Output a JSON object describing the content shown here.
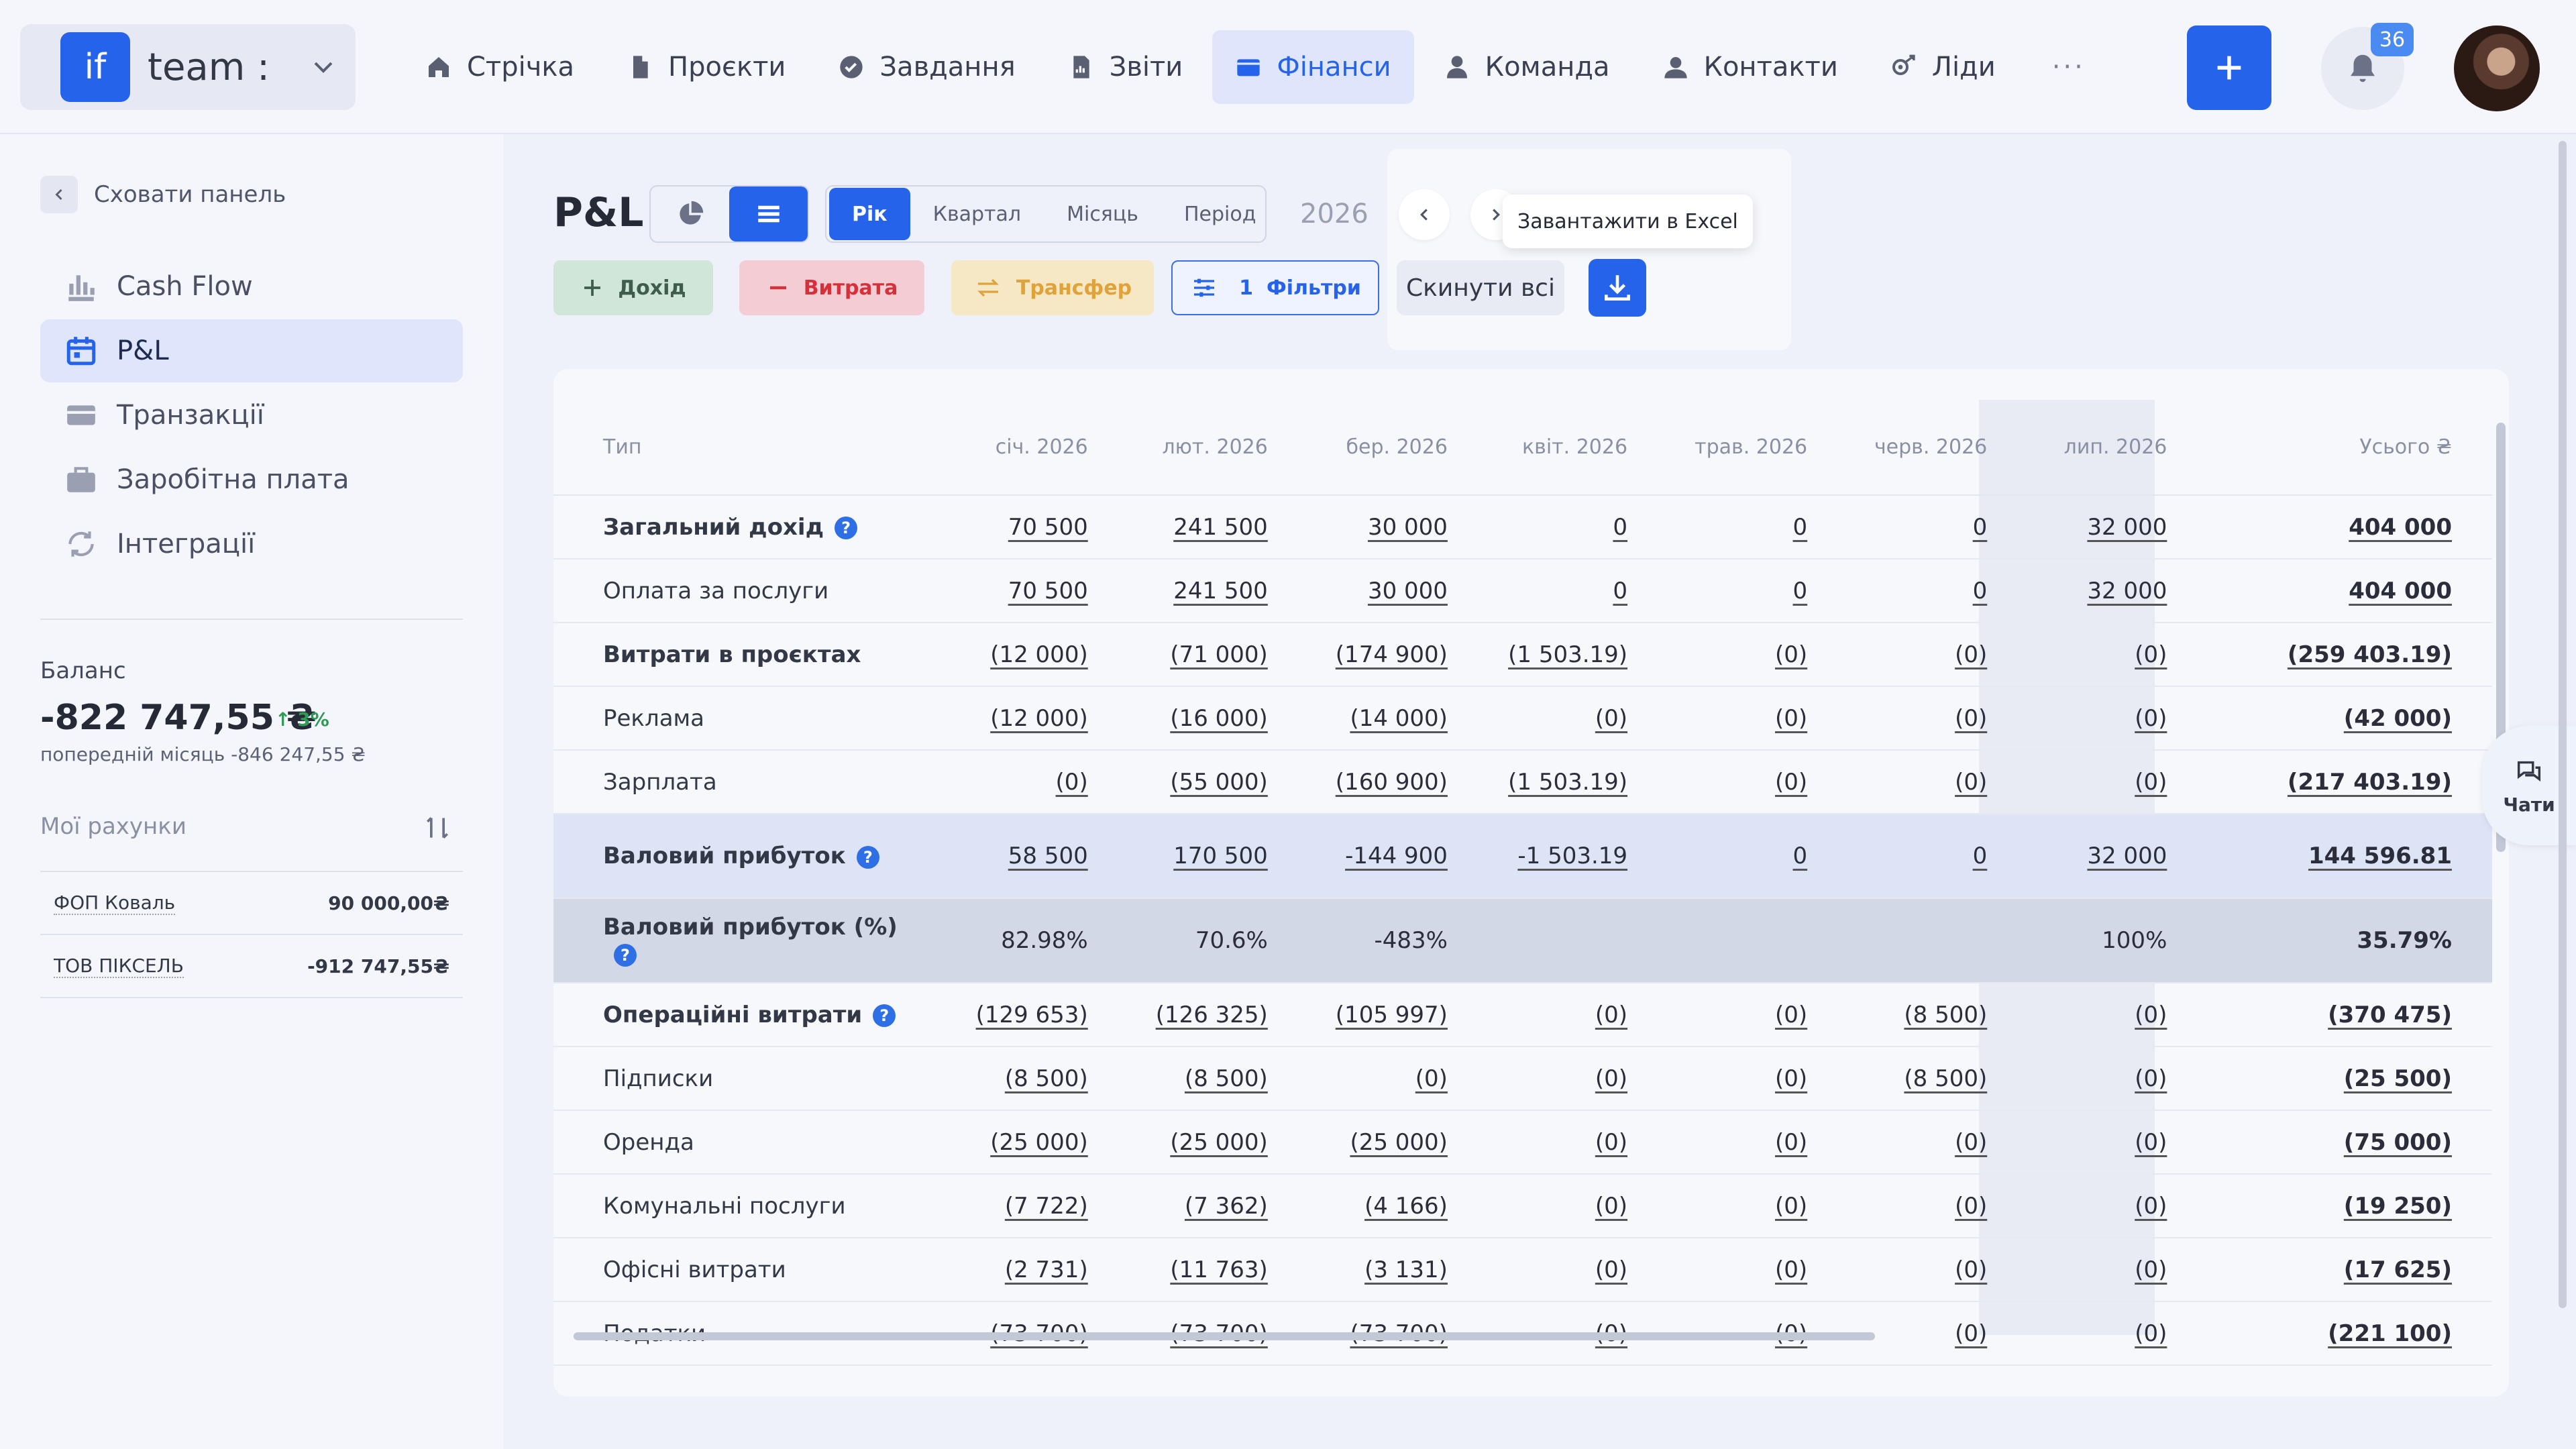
{
  "team": {
    "logo": "if",
    "name": "team :"
  },
  "nav": [
    {
      "label": "Стрічка",
      "icon": "home-icon"
    },
    {
      "label": "Проєкти",
      "icon": "file-icon"
    },
    {
      "label": "Завдання",
      "icon": "check-circle-icon"
    },
    {
      "label": "Звіти",
      "icon": "report-icon"
    },
    {
      "label": "Фінанси",
      "icon": "wallet-icon",
      "active": true
    },
    {
      "label": "Команда",
      "icon": "user-icon"
    },
    {
      "label": "Контакти",
      "icon": "contacts-icon"
    },
    {
      "label": "Ліди",
      "icon": "leads-icon"
    }
  ],
  "nav_more": "···",
  "notifications_count": "36",
  "sidebar": {
    "hide_label": "Сховати панель",
    "items": [
      {
        "label": "Cash Flow",
        "icon": "bar-chart-icon"
      },
      {
        "label": "P&L",
        "icon": "calendar-icon",
        "active": true
      },
      {
        "label": "Транзакції",
        "icon": "card-icon"
      },
      {
        "label": "Заробітна плата",
        "icon": "briefcase-icon"
      },
      {
        "label": "Інтеграції",
        "icon": "sync-icon"
      }
    ],
    "balance_label": "Баланс",
    "balance_value": "-822 747,55 ₴",
    "balance_change": "3%",
    "balance_prev": "попередній місяць -846 247,55 ₴",
    "accounts_label": "Мої рахунки",
    "accounts": [
      {
        "name": "ФОП Коваль",
        "value": "90 000,00₴"
      },
      {
        "name": "ТОВ ПІКСЕЛЬ",
        "value": "-912 747,55₴"
      }
    ]
  },
  "header": {
    "title": "P&L",
    "periods": [
      "Рік",
      "Квартал",
      "Місяць",
      "Період"
    ],
    "active_period": "Рік",
    "year": "2026",
    "tooltip": "Завантажити в Excel",
    "reset_label": "Скинути всі",
    "buttons": {
      "income": "Дохід",
      "expense": "Витрата",
      "transfer": "Трансфер",
      "filters_count": "1",
      "filters": "Фільтри"
    }
  },
  "table": {
    "columns": [
      "Тип",
      "січ. 2026",
      "лют. 2026",
      "бер. 2026",
      "квіт. 2026",
      "трав. 2026",
      "черв. 2026",
      "лип. 2026",
      "Усього ₴"
    ],
    "rows": [
      {
        "label": "Загальний дохід",
        "bold": true,
        "help": true,
        "values": [
          "70 500",
          "241 500",
          "30 000",
          "0",
          "0",
          "0",
          "32 000",
          "404 000"
        ]
      },
      {
        "label": "Оплата за послуги",
        "values": [
          "70 500",
          "241 500",
          "30 000",
          "0",
          "0",
          "0",
          "32 000",
          "404 000"
        ]
      },
      {
        "label": "Витрати в проєктах",
        "bold": true,
        "values": [
          "(12 000)",
          "(71 000)",
          "(174 900)",
          "(1 503.19)",
          "(0)",
          "(0)",
          "(0)",
          "(259 403.19)"
        ]
      },
      {
        "label": "Реклама",
        "values": [
          "(12 000)",
          "(16 000)",
          "(14 000)",
          "(0)",
          "(0)",
          "(0)",
          "(0)",
          "(42 000)"
        ]
      },
      {
        "label": "Зарплата",
        "values": [
          "(0)",
          "(55 000)",
          "(160 900)",
          "(1 503.19)",
          "(0)",
          "(0)",
          "(0)",
          "(217 403.19)"
        ]
      },
      {
        "label": "Валовий прибуток",
        "bold": true,
        "help": true,
        "kind": "gross",
        "values": [
          "58 500",
          "170 500",
          "-144 900",
          "-1 503.19",
          "0",
          "0",
          "32 000",
          "144 596.81"
        ]
      },
      {
        "label": "Валовий прибуток (%)",
        "bold": true,
        "help": true,
        "kind": "grosspct",
        "values": [
          "82.98%",
          "70.6%",
          "-483%",
          "",
          "",
          "",
          "100%",
          "35.79%"
        ]
      },
      {
        "label": "Операційні витрати",
        "bold": true,
        "help": true,
        "values": [
          "(129 653)",
          "(126 325)",
          "(105 997)",
          "(0)",
          "(0)",
          "(8 500)",
          "(0)",
          "(370 475)"
        ]
      },
      {
        "label": "Підписки",
        "values": [
          "(8 500)",
          "(8 500)",
          "(0)",
          "(0)",
          "(0)",
          "(8 500)",
          "(0)",
          "(25 500)"
        ]
      },
      {
        "label": "Оренда",
        "values": [
          "(25 000)",
          "(25 000)",
          "(25 000)",
          "(0)",
          "(0)",
          "(0)",
          "(0)",
          "(75 000)"
        ]
      },
      {
        "label": "Комунальні послуги",
        "values": [
          "(7 722)",
          "(7 362)",
          "(4 166)",
          "(0)",
          "(0)",
          "(0)",
          "(0)",
          "(19 250)"
        ]
      },
      {
        "label": "Офісні витрати",
        "values": [
          "(2 731)",
          "(11 763)",
          "(3 131)",
          "(0)",
          "(0)",
          "(0)",
          "(0)",
          "(17 625)"
        ]
      },
      {
        "label": "Податки",
        "values": [
          "(73 700)",
          "(73 700)",
          "(73 700)",
          "(0)",
          "(0)",
          "(0)",
          "(0)",
          "(221 100)"
        ]
      }
    ]
  },
  "chat_label": "Чати",
  "colors": {
    "accent": "#2563eb",
    "income": "#cfe6d8",
    "expense": "#f4cdd4",
    "transfer": "#f6e8c4"
  }
}
